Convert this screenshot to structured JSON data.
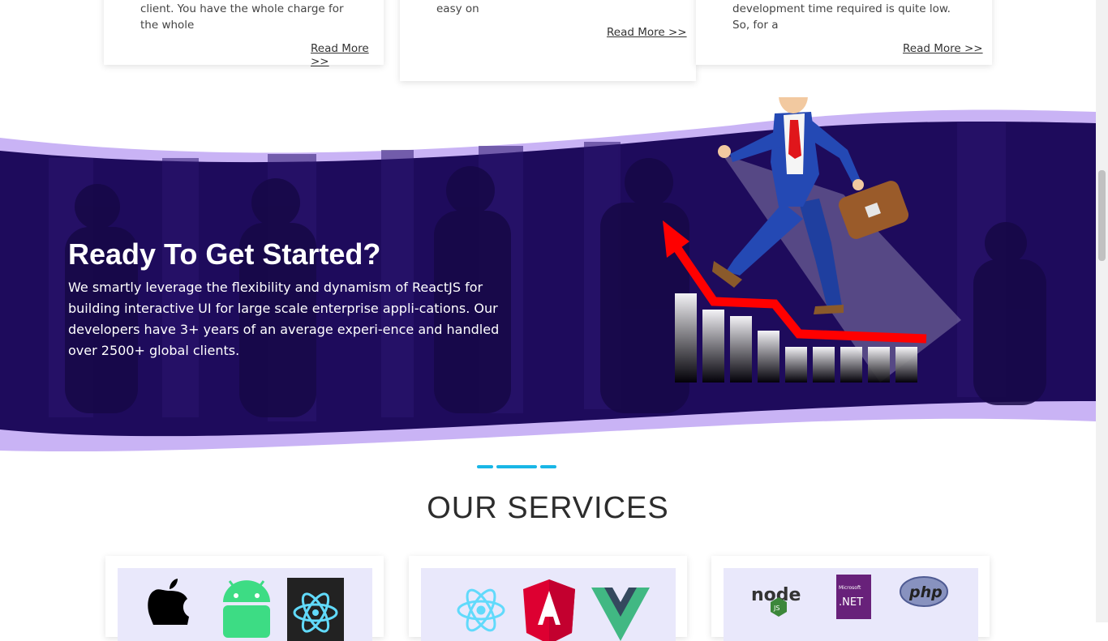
{
  "cards": [
    {
      "text": "client. You have the whole charge for the whole",
      "read_more": "Read More >>"
    },
    {
      "text": "easy on",
      "read_more": "Read More >>"
    },
    {
      "text": "development time required is quite low. So, for a",
      "read_more": "Read More >>"
    }
  ],
  "banner": {
    "title": "Ready To Get Started?",
    "body": "We smartly leverage the flexibility and dynamism of ReactJS for building interactive UI for large scale enterprise appli-cations. Our developers have 3+ years of an average experi-ence and handled over 2500+ global clients."
  },
  "services": {
    "title": "OUR SERVICES",
    "cards": [
      {
        "icons": [
          "apple-logo-icon",
          "android-logo-icon",
          "react-native-logo-icon"
        ]
      },
      {
        "icons": [
          "react-logo-icon",
          "angular-logo-icon",
          "vue-logo-icon"
        ]
      },
      {
        "icons": [
          "nodejs-logo-icon",
          "dotnet-logo-icon",
          "php-logo-icon"
        ]
      }
    ],
    "logo_text": {
      "node": "node",
      "node_js": "JS",
      "ms": "Microsoft",
      "net": ".NET",
      "php": "php"
    }
  },
  "colors": {
    "banner_dark": "#1e0b5c",
    "banner_lavender": "#c9b3f5",
    "accent_cyan": "#19b6e6",
    "arrow_red": "#ff0000",
    "suit_blue": "#2449b4"
  }
}
